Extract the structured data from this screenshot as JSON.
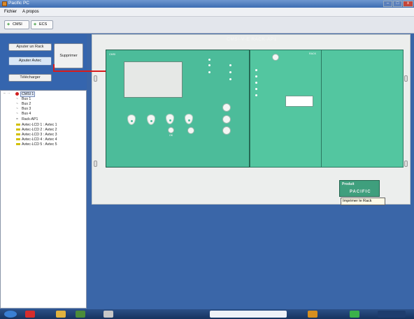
{
  "window": {
    "title": "Pacific PC",
    "controls": {
      "minimize": "–",
      "maximize": "□",
      "close": "x"
    }
  },
  "menu": {
    "items": [
      "Fichier",
      "A propos"
    ]
  },
  "toolbar": {
    "buttons": [
      {
        "label": "CMSI",
        "icon": "plus-icon"
      },
      {
        "label": "ECS",
        "icon": "plus-icon"
      }
    ]
  },
  "left_actions": {
    "add_rack": "Ajouter un Rack",
    "add_card": "Ajouter Avtec",
    "delete": "Supprimer",
    "upload": "Télécharger"
  },
  "tree": {
    "root": "CMSI 1",
    "items": [
      "Bus 1",
      "Bus 2",
      "Bus 3",
      "Bus 4",
      "Rack-AP1",
      "Avtec-LCD 1 : Avtec 1",
      "Avtec-LCD 2 : Avtec 2",
      "Avtec-LCD 3 : Avtec 3",
      "Avtec-LCD 4 : Avtec 4",
      "Avtec-LCD 5 : Avtec 5"
    ]
  },
  "rack": {
    "title": "CMSI-V-E RACK-AP1",
    "left_module_label": "CMSI",
    "right_module_label": "RACK",
    "ok_label": "OK",
    "badge_brand": "Produit",
    "badge_name": "PACIFIC",
    "tooltip": "Imprimer le Rack"
  },
  "colors": {
    "panel_green": "#4cbc9a",
    "annotation_red": "#d81b1b",
    "window_blue": "#3a66a8"
  }
}
